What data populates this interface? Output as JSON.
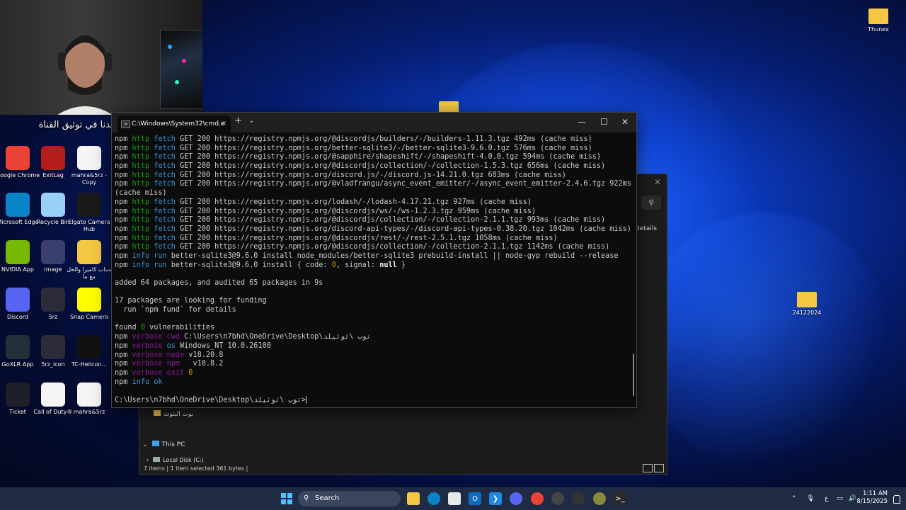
{
  "overlay": {
    "marquee_text": "الاشتراك مو اجباري لاكن يساعدنا في توثيق القناة"
  },
  "desktop": {
    "left_icons": [
      {
        "label": "Google Chrome",
        "icon": "chrome-icon",
        "color": "#ea4335"
      },
      {
        "label": "ExitLag",
        "icon": "exitlag-icon",
        "color": "#b71c1c"
      },
      {
        "label": "mahra&5rz - Copy",
        "icon": "document-icon",
        "color": "#f5f5f5"
      },
      {
        "label": "Microsoft Edge",
        "icon": "edge-icon",
        "color": "#0a84c6"
      },
      {
        "label": "Recycle Bin",
        "icon": "recycle-bin-icon",
        "color": "#9ad0f5"
      },
      {
        "label": "Elgato Camera Hub",
        "icon": "camera-hub-icon",
        "color": "#1a1a1a"
      },
      {
        "label": "NVIDIA App",
        "icon": "nvidia-icon",
        "color": "#76b900"
      },
      {
        "label": "image",
        "icon": "image-file-icon",
        "color": "#3a3f6b"
      },
      {
        "label": "سناب كاميرا والحل مع ما",
        "icon": "folder-icon",
        "color": "#f6c744"
      },
      {
        "label": "Discord",
        "icon": "discord-icon",
        "color": "#5865f2"
      },
      {
        "label": "5rz",
        "icon": "5rz-icon",
        "color": "#2b2b3a"
      },
      {
        "label": "Snap Camera",
        "icon": "snap-camera-icon",
        "color": "#fffc00"
      },
      {
        "label": "GoXLR App",
        "icon": "goxlr-icon",
        "color": "#22303a"
      },
      {
        "label": "5rz_icon",
        "icon": "5rz-icon",
        "color": "#2b2b3a"
      },
      {
        "label": "TC-Helicon...",
        "icon": "tc-helicon-icon",
        "color": "#111111"
      },
      {
        "label": "Ticket",
        "icon": "ticket-icon",
        "color": "#1f1f2a"
      },
      {
        "label": "Call of Duty®",
        "icon": "document-icon",
        "color": "#f5f5f5"
      },
      {
        "label": "mahra&5rz",
        "icon": "document-icon",
        "color": "#f5f5f5"
      }
    ],
    "right_icons": [
      {
        "label": "Thunex",
        "icon": "folder-icon"
      },
      {
        "label": "24122024",
        "icon": "folder-icon"
      }
    ]
  },
  "explorer": {
    "details_label": "Details",
    "tree_items": [
      {
        "label": "بوت البثوث",
        "icon": "folder-icon"
      },
      {
        "label": "This PC",
        "icon": "pc-icon"
      },
      {
        "label": "Local Disk (C:)",
        "icon": "disk-icon"
      }
    ],
    "status": {
      "items": "7 items",
      "selected": "1 item selected  361 bytes"
    }
  },
  "terminal": {
    "tab_title": "C:\\Windows\\System32\\cmd.e",
    "lines": [
      {
        "parts": [
          [
            "",
            "npm "
          ],
          [
            "g",
            "http "
          ],
          [
            "c",
            "fetch "
          ],
          [
            "",
            "GET 200 https://registry.npmjs.org/@discordjs/builders/-/builders-1.11.3.tgz 492ms (cache miss)"
          ]
        ]
      },
      {
        "parts": [
          [
            "",
            "npm "
          ],
          [
            "g",
            "http "
          ],
          [
            "c",
            "fetch "
          ],
          [
            "",
            "GET 200 https://registry.npmjs.org/better-sqlite3/-/better-sqlite3-9.6.0.tgz 576ms (cache miss)"
          ]
        ]
      },
      {
        "parts": [
          [
            "",
            "npm "
          ],
          [
            "g",
            "http "
          ],
          [
            "c",
            "fetch "
          ],
          [
            "",
            "GET 200 https://registry.npmjs.org/@sapphire/shapeshift/-/shapeshift-4.0.0.tgz 594ms (cache miss)"
          ]
        ]
      },
      {
        "parts": [
          [
            "",
            "npm "
          ],
          [
            "g",
            "http "
          ],
          [
            "c",
            "fetch "
          ],
          [
            "",
            "GET 200 https://registry.npmjs.org/@discordjs/collection/-/collection-1.5.3.tgz 656ms (cache miss)"
          ]
        ]
      },
      {
        "parts": [
          [
            "",
            "npm "
          ],
          [
            "g",
            "http "
          ],
          [
            "c",
            "fetch "
          ],
          [
            "",
            "GET 200 https://registry.npmjs.org/discord.js/-/discord.js-14.21.0.tgz 683ms (cache miss)"
          ]
        ]
      },
      {
        "parts": [
          [
            "",
            "npm "
          ],
          [
            "g",
            "http "
          ],
          [
            "c",
            "fetch "
          ],
          [
            "",
            "GET 200 https://registry.npmjs.org/@vladfrangu/async_event_emitter/-/async_event_emitter-2.4.6.tgz 922ms"
          ]
        ]
      },
      {
        "parts": [
          [
            "",
            "(cache miss)"
          ]
        ]
      },
      {
        "parts": [
          [
            "",
            "npm "
          ],
          [
            "g",
            "http "
          ],
          [
            "c",
            "fetch "
          ],
          [
            "",
            "GET 200 https://registry.npmjs.org/lodash/-/lodash-4.17.21.tgz 927ms (cache miss)"
          ]
        ]
      },
      {
        "parts": [
          [
            "",
            "npm "
          ],
          [
            "g",
            "http "
          ],
          [
            "c",
            "fetch "
          ],
          [
            "",
            "GET 200 https://registry.npmjs.org/@discordjs/ws/-/ws-1.2.3.tgz 959ms (cache miss)"
          ]
        ]
      },
      {
        "parts": [
          [
            "",
            "npm "
          ],
          [
            "g",
            "http "
          ],
          [
            "c",
            "fetch "
          ],
          [
            "",
            "GET 200 https://registry.npmjs.org/@discordjs/collection/-/collection-2.1.1.tgz 993ms (cache miss)"
          ]
        ]
      },
      {
        "parts": [
          [
            "",
            "npm "
          ],
          [
            "g",
            "http "
          ],
          [
            "c",
            "fetch "
          ],
          [
            "",
            "GET 200 https://registry.npmjs.org/discord-api-types/-/discord-api-types-0.38.20.tgz 1042ms (cache miss)"
          ]
        ]
      },
      {
        "parts": [
          [
            "",
            "npm "
          ],
          [
            "g",
            "http "
          ],
          [
            "c",
            "fetch "
          ],
          [
            "",
            "GET 200 https://registry.npmjs.org/@discordjs/rest/-/rest-2.5.1.tgz 1058ms (cache miss)"
          ]
        ]
      },
      {
        "parts": [
          [
            "",
            "npm "
          ],
          [
            "g",
            "http "
          ],
          [
            "c",
            "fetch "
          ],
          [
            "",
            "GET 200 https://registry.npmjs.org/@discordjs/collection/-/collection-2.1.1.tgz 1142ms (cache miss)"
          ]
        ]
      },
      {
        "parts": [
          [
            "",
            "npm "
          ],
          [
            "c",
            "info "
          ],
          [
            "c",
            "run "
          ],
          [
            "",
            "better-sqlite3@9.6.0 install node_modules/better-sqlite3 prebuild-install || node-gyp rebuild --release"
          ]
        ]
      },
      {
        "parts": [
          [
            "",
            "npm "
          ],
          [
            "c",
            "info "
          ],
          [
            "c",
            "run "
          ],
          [
            "",
            "better-sqlite3@9.6.0 install { code: "
          ],
          [
            "num",
            "0"
          ],
          [
            "",
            ", signal: "
          ],
          [
            "w",
            "null"
          ],
          [
            "",
            " }"
          ]
        ]
      },
      {
        "parts": [
          [
            "",
            ""
          ]
        ]
      },
      {
        "parts": [
          [
            "",
            "added 64 packages, and audited 65 packages in 9s"
          ]
        ]
      },
      {
        "parts": [
          [
            "",
            ""
          ]
        ]
      },
      {
        "parts": [
          [
            "",
            "17 packages are looking for funding"
          ]
        ]
      },
      {
        "parts": [
          [
            "",
            "  run `npm fund` for details"
          ]
        ]
      },
      {
        "parts": [
          [
            "",
            ""
          ]
        ]
      },
      {
        "parts": [
          [
            "",
            "found "
          ],
          [
            "g",
            "0"
          ],
          [
            "",
            " vulnerabilities"
          ]
        ]
      },
      {
        "parts": [
          [
            "",
            "npm "
          ],
          [
            "m",
            "verbose "
          ],
          [
            "m",
            "cwd "
          ],
          [
            "",
            "C:\\Users\\n7bhd\\OneDrive\\Desktop\\توب \\ثوثيلد"
          ]
        ]
      },
      {
        "parts": [
          [
            "",
            "npm "
          ],
          [
            "m",
            "verbose "
          ],
          [
            "c",
            "os "
          ],
          [
            "",
            "Windows_NT 10.0.26100"
          ]
        ]
      },
      {
        "parts": [
          [
            "",
            "npm "
          ],
          [
            "m",
            "verbose "
          ],
          [
            "m",
            "node "
          ],
          [
            "",
            "v18.20.8"
          ]
        ]
      },
      {
        "parts": [
          [
            "",
            "npm "
          ],
          [
            "m",
            "verbose "
          ],
          [
            "m",
            "npm "
          ],
          [
            "",
            "  v10.8.2"
          ]
        ]
      },
      {
        "parts": [
          [
            "",
            "npm "
          ],
          [
            "m",
            "verbose "
          ],
          [
            "m",
            "exit "
          ],
          [
            "num",
            "0"
          ]
        ]
      },
      {
        "parts": [
          [
            "",
            "npm "
          ],
          [
            "c",
            "info "
          ],
          [
            "c",
            "ok"
          ]
        ]
      },
      {
        "parts": [
          [
            "",
            ""
          ]
        ]
      },
      {
        "parts": [
          [
            "",
            "C:\\Users\\n7bhd\\OneDrive\\Desktop\\توب \\ثوثيلد>"
          ]
        ]
      }
    ]
  },
  "taskbar": {
    "search_label": "Search",
    "language": "ع",
    "time": "1:11 AM",
    "date": "8/15/2025"
  }
}
